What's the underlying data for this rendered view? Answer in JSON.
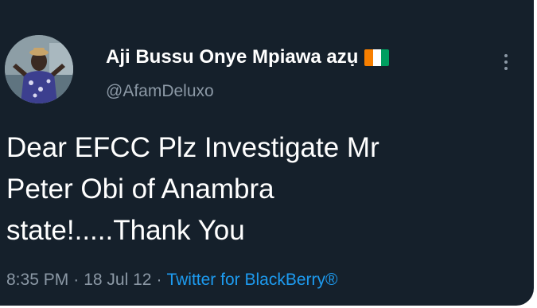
{
  "user": {
    "display_name": "Aji Bussu Onye Mpiawa azụ",
    "handle": "@AfamDeluxo",
    "flag_colors": [
      "#f77f00",
      "#ffffff",
      "#009e60"
    ]
  },
  "tweet": {
    "lines": [
      "Dear EFCC Plz Investigate Mr",
      "Peter Obi of Anambra",
      "state!.....Thank You"
    ],
    "time": "8:35 PM",
    "separator": "·",
    "date": "18 Jul 12",
    "source": "Twitter for BlackBerry®"
  },
  "theme": {
    "background": "#15202b",
    "text": "#ffffff",
    "secondary_text": "#8b98a5",
    "link": "#1d9bf0"
  },
  "icons": {
    "more": "more-vertical-icon",
    "flag": "ivory-coast-flag"
  }
}
